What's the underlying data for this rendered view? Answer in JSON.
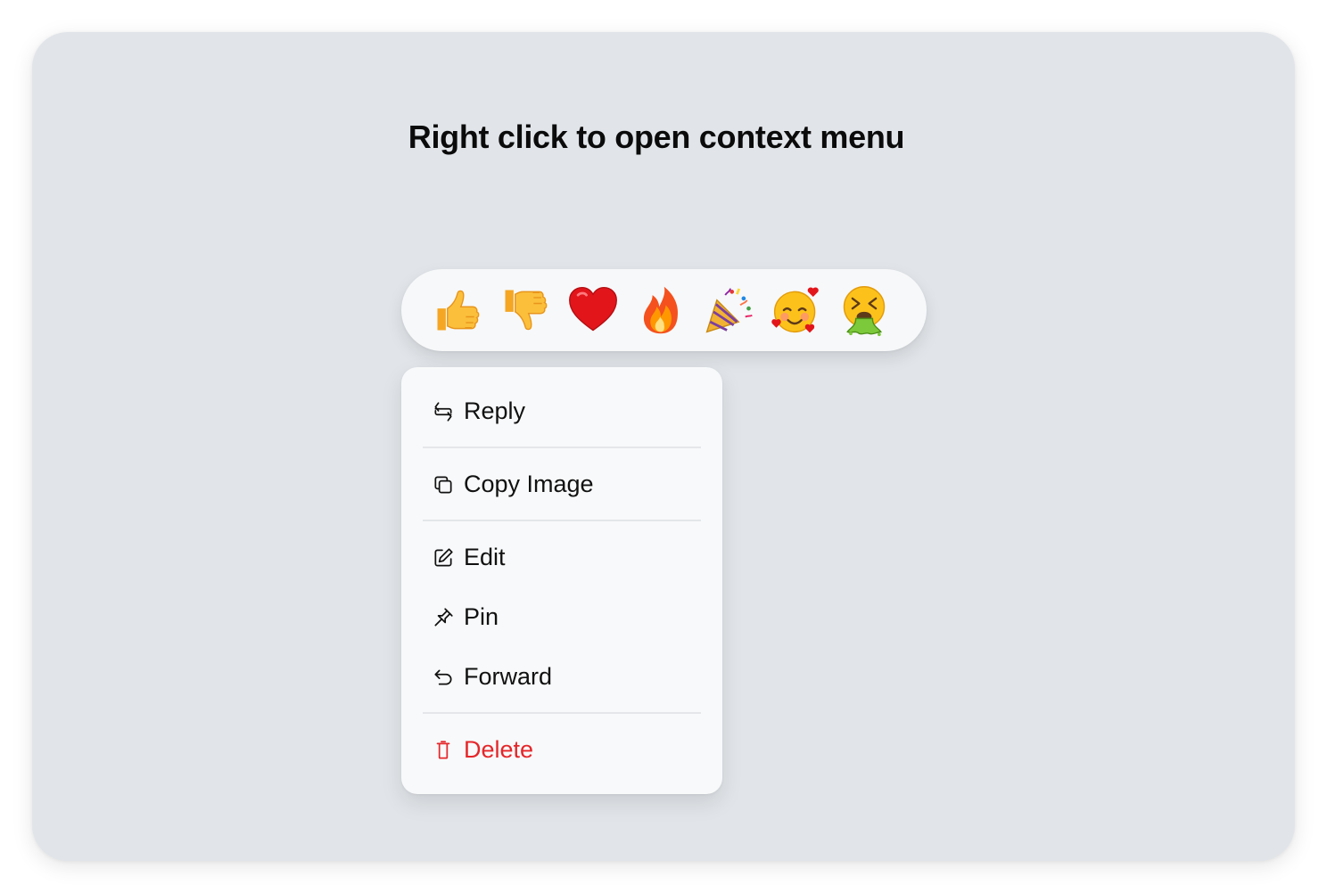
{
  "heading": "Right click to open context menu",
  "reactions": [
    {
      "name": "thumbs-up-emoji"
    },
    {
      "name": "thumbs-down-emoji"
    },
    {
      "name": "red-heart-emoji"
    },
    {
      "name": "fire-emoji"
    },
    {
      "name": "party-popper-emoji"
    },
    {
      "name": "smiling-face-with-hearts-emoji"
    },
    {
      "name": "face-vomiting-emoji"
    }
  ],
  "menu": {
    "reply": "Reply",
    "copy_image": "Copy Image",
    "edit": "Edit",
    "pin": "Pin",
    "forward": "Forward",
    "delete": "Delete"
  },
  "colors": {
    "background": "#e1e5e9",
    "panel": "#f8f9fa",
    "danger": "#e5262a"
  }
}
